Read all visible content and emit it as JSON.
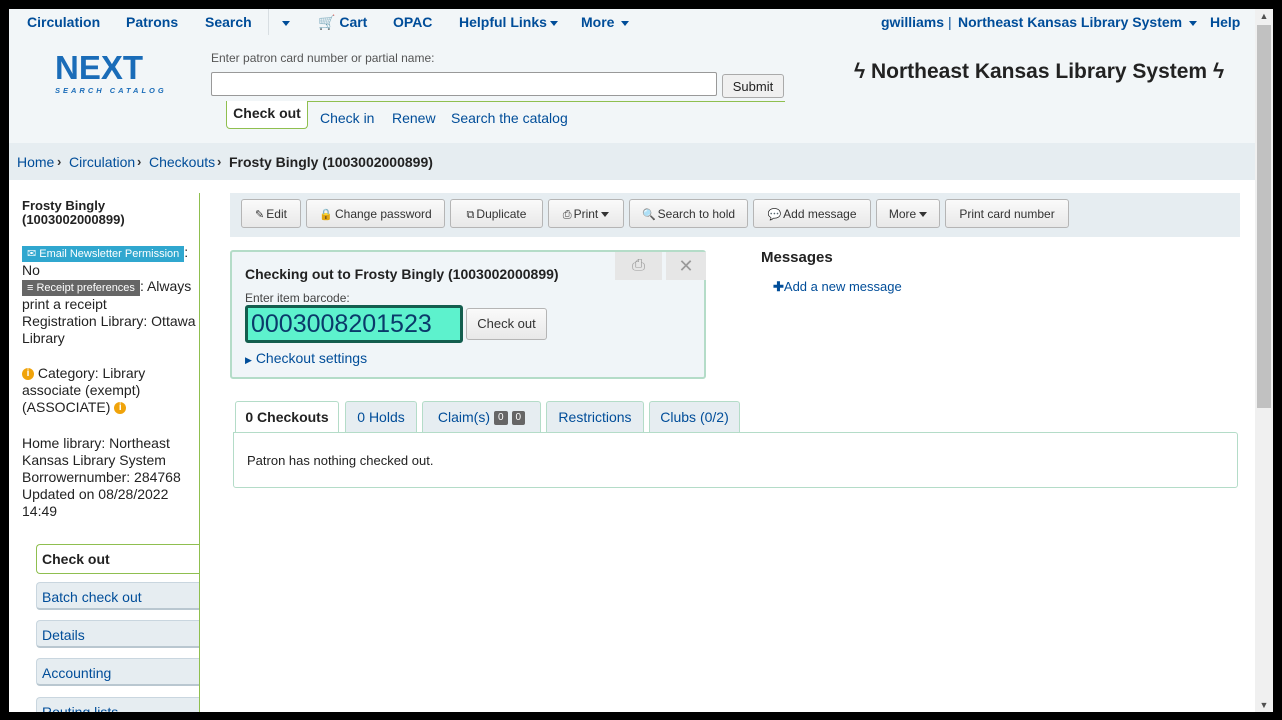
{
  "nav": {
    "items": [
      "Circulation",
      "Patrons",
      "Search",
      "Cart",
      "OPAC",
      "Helpful Links",
      "More"
    ],
    "user": "gwilliams",
    "branch": "Northeast Kansas Library System",
    "help": "Help"
  },
  "logo": {
    "big": "NEXT",
    "small": "SEARCH CATALOG"
  },
  "search": {
    "label": "Enter patron card number or partial name:",
    "value": "",
    "submit": "Submit",
    "tabs": [
      "Check out",
      "Check in",
      "Renew",
      "Search the catalog"
    ]
  },
  "site_title": "Northeast Kansas Library System",
  "breadcrumb": [
    "Home",
    "Circulation",
    "Checkouts",
    "Frosty Bingly (1003002000899)"
  ],
  "patron": {
    "name": "Frosty Bingly",
    "card": "(1003002000899)",
    "email_badge": "Email Newsletter Permission",
    "email_value": ": No",
    "receipt_badge": "Receipt preferences",
    "receipt_value_1": ": Always",
    "receipt_value_2": "print a receipt",
    "registration_1": "Registration Library: Ottawa",
    "registration_2": "Library",
    "category_1": "Category: Library",
    "category_2": "associate (exempt)",
    "category_3": "(ASSOCIATE)",
    "home_1": "Home library: Northeast",
    "home_2": "Kansas Library System",
    "borrowernumber": "Borrowernumber: 284768",
    "updated_1": "Updated on 08/28/2022",
    "updated_2": "14:49"
  },
  "left_nav": [
    "Check out",
    "Batch check out",
    "Details",
    "Accounting",
    "Routing lists"
  ],
  "toolbar": [
    "Edit",
    "Change password",
    "Duplicate",
    "Print",
    "Search to hold",
    "Add message",
    "More",
    "Print card number"
  ],
  "checkout": {
    "title": "Checking out to Frosty Bingly (1003002000899)",
    "barcode_label": "Enter item barcode:",
    "barcode_value": "0003008201523",
    "button": "Check out",
    "settings": "Checkout settings"
  },
  "messages": {
    "title": "Messages",
    "add": "Add a new message"
  },
  "tabs": {
    "checkouts": "0 Checkouts",
    "holds": "0 Holds",
    "claims": "Claim(s)",
    "claims_count_1": "0",
    "claims_count_2": "0",
    "restrictions": "Restrictions",
    "clubs": "Clubs (0/2)"
  },
  "tab_content": "Patron has nothing checked out.",
  "colors": {
    "link": "#004d99",
    "accent_green": "#8fbf4f",
    "barcode_bg": "#5df2cd",
    "email_badge": "#30a7cf",
    "receipt_badge": "#666666"
  }
}
